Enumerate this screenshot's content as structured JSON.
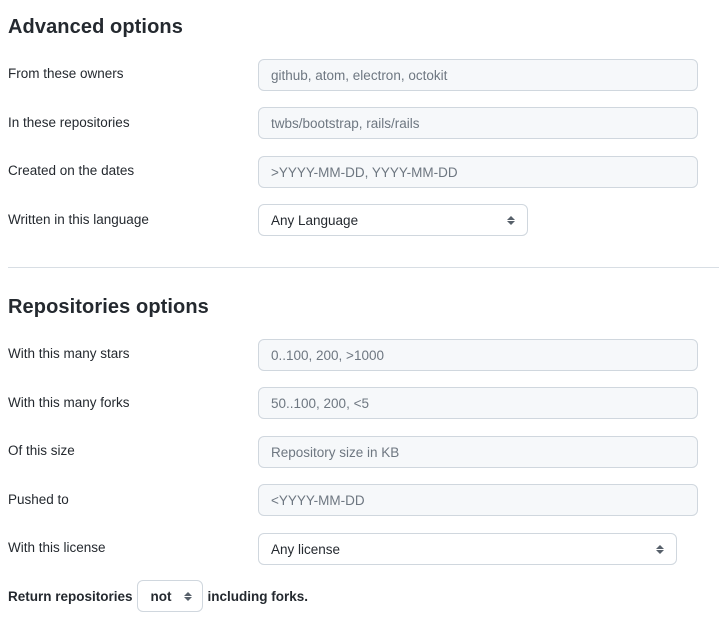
{
  "advanced": {
    "title": "Advanced options",
    "rows": [
      {
        "label": "From these owners",
        "placeholder": "github, atom, electron, octokit"
      },
      {
        "label": "In these repositories",
        "placeholder": "twbs/bootstrap, rails/rails"
      },
      {
        "label": "Created on the dates",
        "placeholder": ">YYYY-MM-DD, YYYY-MM-DD"
      }
    ],
    "language": {
      "label": "Written in this language",
      "value": "Any Language"
    }
  },
  "repositories": {
    "title": "Repositories options",
    "rows": [
      {
        "label": "With this many stars",
        "placeholder": "0..100, 200, >1000"
      },
      {
        "label": "With this many forks",
        "placeholder": "50..100, 200, <5"
      },
      {
        "label": "Of this size",
        "placeholder": "Repository size in KB"
      },
      {
        "label": "Pushed to",
        "placeholder": "<YYYY-MM-DD"
      }
    ],
    "license": {
      "label": "With this license",
      "value": "Any license"
    }
  },
  "forks": {
    "prefix": "Return repositories",
    "value": "not",
    "suffix": "including forks."
  }
}
